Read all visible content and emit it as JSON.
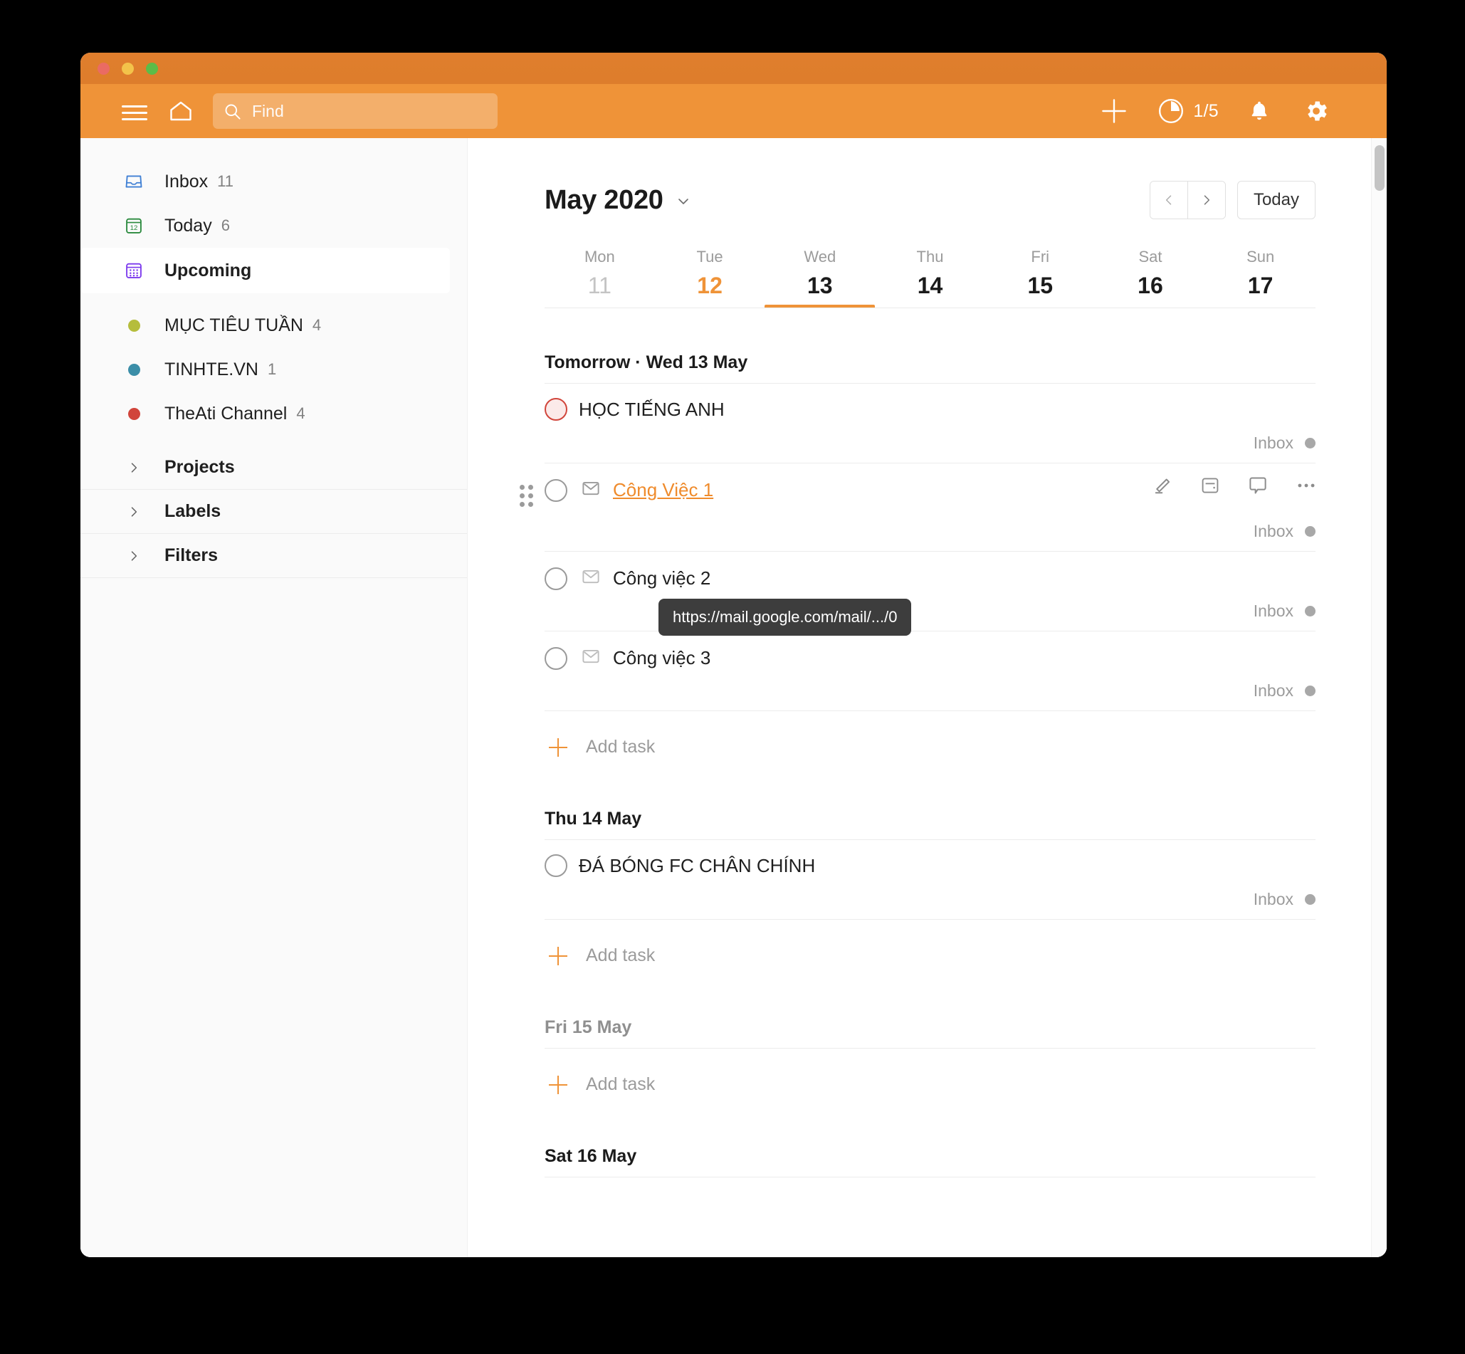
{
  "window": {
    "traffic_lights": [
      "close-red",
      "minimize-yellow",
      "maximize-green"
    ],
    "colors": {
      "titlebar": "#e07e2d",
      "toolbar": "#ef9338",
      "accent": "#ef9338",
      "sidebar_bg": "#fafafa",
      "priority_red": "#d1453b"
    }
  },
  "toolbar": {
    "menu_icon": "hamburger-icon",
    "home_icon": "home-icon",
    "search": {
      "icon": "search-icon",
      "placeholder": "Find",
      "value": ""
    },
    "add_icon": "plus-icon",
    "progress": {
      "icon": "progress-circle-icon",
      "label": "1/5"
    },
    "notifications_icon": "bell-icon",
    "settings_icon": "gear-icon"
  },
  "sidebar": {
    "items": [
      {
        "label": "Inbox",
        "count": "11",
        "icon": "inbox-icon",
        "icon_color": "#3f7fd4"
      },
      {
        "label": "Today",
        "count": "6",
        "icon": "calendar-12-icon",
        "icon_color": "#2b8a3e"
      },
      {
        "label": "Upcoming",
        "count": "",
        "icon": "upcoming-grid-icon",
        "icon_color": "#7c3aed",
        "active": true
      }
    ],
    "projects": [
      {
        "label": "MỤC TIÊU TUẦN",
        "count": "4",
        "dot_color": "#b5bd3c"
      },
      {
        "label": "TINHTE.VN",
        "count": "1",
        "dot_color": "#3b8ea8"
      },
      {
        "label": "TheAti Channel",
        "count": "4",
        "dot_color": "#d1453b"
      }
    ],
    "groups": [
      {
        "label": "Projects",
        "icon": "chevron-right-icon"
      },
      {
        "label": "Labels",
        "icon": "chevron-right-icon"
      },
      {
        "label": "Filters",
        "icon": "chevron-right-icon"
      }
    ]
  },
  "main": {
    "month_title": "May 2020",
    "month_chevron_icon": "chevron-down-icon",
    "nav": {
      "prev_icon": "chevron-left-icon",
      "next_icon": "chevron-right-icon",
      "today_label": "Today"
    },
    "days": [
      {
        "name": "Mon",
        "num": "11",
        "muted": true,
        "dot": "none",
        "selected": false
      },
      {
        "name": "Tue",
        "num": "12",
        "today": true,
        "dot": "grey",
        "selected": false
      },
      {
        "name": "Wed",
        "num": "13",
        "muted": false,
        "dot": "accent",
        "selected": true
      },
      {
        "name": "Thu",
        "num": "14",
        "muted": false,
        "dot": "grey",
        "selected": false
      },
      {
        "name": "Fri",
        "num": "15",
        "muted": false,
        "dot": "none",
        "selected": false
      },
      {
        "name": "Sat",
        "num": "16",
        "muted": false,
        "dot": "grey",
        "selected": false
      },
      {
        "name": "Sun",
        "num": "17",
        "muted": false,
        "dot": "grey",
        "selected": false
      }
    ],
    "sections": [
      {
        "title": "Tomorrow · Wed 13 May",
        "muted": false,
        "tasks": [
          {
            "text": "HỌC TIẾNG ANH",
            "priority": "p1",
            "has_mail_icon": false,
            "is_link": false,
            "project": "Inbox",
            "hovered": false
          },
          {
            "text": "Công Việc 1",
            "priority": "p4",
            "has_mail_icon": true,
            "is_link": true,
            "project": "Inbox",
            "hovered": true
          },
          {
            "text": "Công việc 2",
            "priority": "p4",
            "has_mail_icon": true,
            "is_link": false,
            "project": "Inbox",
            "hovered": false
          },
          {
            "text": "Công việc 3",
            "priority": "p4",
            "has_mail_icon": true,
            "is_link": false,
            "project": "Inbox",
            "hovered": false
          }
        ],
        "add_label": "Add task"
      },
      {
        "title": "Thu 14 May",
        "muted": false,
        "tasks": [
          {
            "text": "ĐÁ BÓNG FC CHÂN CHÍNH",
            "priority": "p4",
            "has_mail_icon": false,
            "is_link": false,
            "project": "Inbox",
            "hovered": false
          }
        ],
        "add_label": "Add task"
      },
      {
        "title": "Fri 15 May",
        "muted": true,
        "tasks": [],
        "add_label": "Add task"
      },
      {
        "title": "Sat 16 May",
        "muted": false,
        "tasks": [],
        "add_label": ""
      }
    ],
    "row_actions": [
      {
        "name": "edit-pencil-icon"
      },
      {
        "name": "schedule-calendar-icon"
      },
      {
        "name": "comment-bubble-icon"
      },
      {
        "name": "more-options-icon"
      }
    ]
  },
  "tooltip": {
    "text": "https://mail.google.com/mail/.../0"
  }
}
